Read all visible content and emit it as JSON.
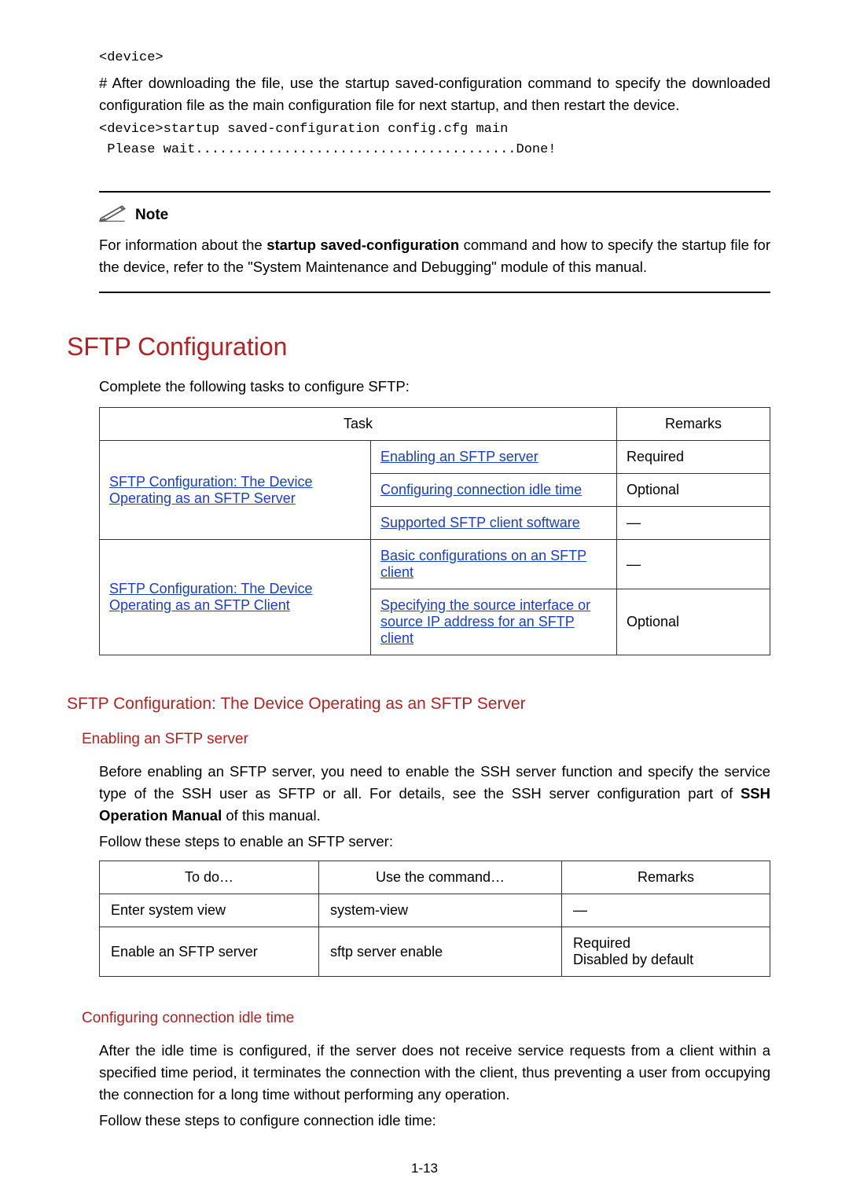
{
  "code_top_1": "<device>",
  "para_after_download": "# After downloading the file, use the startup saved-configuration command to specify the downloaded configuration file as the main configuration file for next startup, and then restart the device.",
  "code_top_2": "<device>startup saved-configuration config.cfg main",
  "code_top_3": " Please wait........................................Done!",
  "note": {
    "label": "Note",
    "body_part1": "For information about the ",
    "body_bold1": "startup saved-configuration",
    "body_part2": " command and how to specify the startup file for the device, refer to the \"System Maintenance and Debugging\" module of this manual."
  },
  "h1": "SFTP Configuration",
  "intro_sftp": "Complete the following tasks to configure SFTP:",
  "tasks_table": {
    "head_task": "Task",
    "head_remarks": "Remarks",
    "row1_left": "SFTP Configuration: The Device Operating as an SFTP Server",
    "row1a_task": "Enabling an SFTP server",
    "row1a_rem": "Required",
    "row1b_task": "Configuring connection idle time",
    "row1b_rem": "Optional",
    "row1c_task": "Supported SFTP client software",
    "row1c_rem": "—",
    "row2_left": "SFTP Configuration: The Device Operating as an SFTP Client",
    "row2a_task": "Basic configurations on an SFTP client",
    "row2a_rem": "—",
    "row2b_task": "Specifying the source interface or source IP address for an SFTP client",
    "row2b_rem": "Optional"
  },
  "h2": "SFTP Configuration: The Device    Operating as an SFTP Server",
  "h3a": "Enabling an SFTP server",
  "enable_para_1a": "Before enabling an SFTP server, you need to enable the SSH server function and specify the service type of the SSH user as SFTP or all. For details, see the SSH server configuration part of ",
  "enable_para_1b_bold": "SSH Operation Manual",
  "enable_para_1c": " of this manual.",
  "enable_para_2": "Follow these steps to enable an SFTP server:",
  "cmd_table": {
    "h_todo": "To do…",
    "h_use": "Use the command…",
    "h_rem": "Remarks",
    "r1_c1": "Enter system view",
    "r1_c2": "system-view",
    "r1_c3": "—",
    "r2_c1": "Enable an SFTP server",
    "r2_c2": "sftp server enable",
    "r2_c3a": "Required",
    "r2_c3b": "Disabled by default"
  },
  "h3b": "Configuring connection idle time",
  "idle_para_1": "After the idle time is configured, if the server does not receive service requests from a client within a specified time period, it terminates the connection with the client, thus preventing a user from occupying the connection for a long time without performing any operation.",
  "idle_para_2": "Follow these steps to configure connection idle time:",
  "page_num": "1-13"
}
